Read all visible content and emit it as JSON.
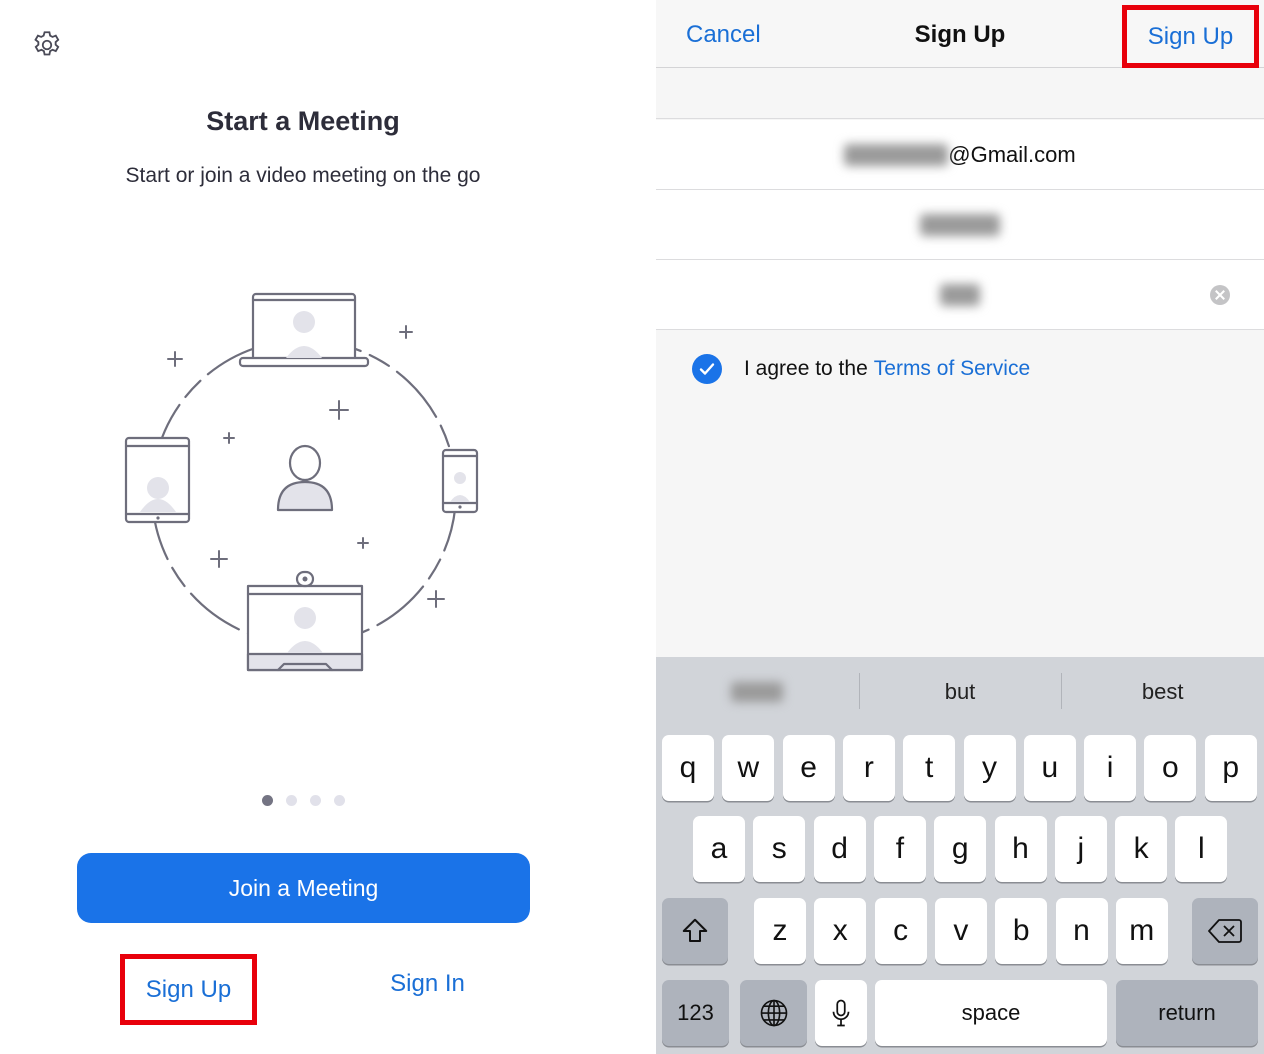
{
  "left": {
    "settings_icon": "gear-icon",
    "title": "Start a Meeting",
    "subtitle": "Start or join a video meeting on the go",
    "page_indicator": {
      "count": 4,
      "active_index": 0
    },
    "join_button": "Join a Meeting",
    "sign_up": "Sign Up",
    "sign_in": "Sign In"
  },
  "right": {
    "nav": {
      "cancel": "Cancel",
      "title": "Sign Up",
      "sign_up": "Sign Up"
    },
    "fields": {
      "email_suffix": "@Gmail.com"
    },
    "agree": {
      "text": "I agree to the",
      "link": "Terms of Service",
      "checked": true
    },
    "keyboard": {
      "suggestions": [
        "",
        "but",
        "best"
      ],
      "row1": [
        "q",
        "w",
        "e",
        "r",
        "t",
        "y",
        "u",
        "i",
        "o",
        "p"
      ],
      "row2": [
        "a",
        "s",
        "d",
        "f",
        "g",
        "h",
        "j",
        "k",
        "l"
      ],
      "row3": [
        "z",
        "x",
        "c",
        "v",
        "b",
        "n",
        "m"
      ],
      "numbers_key": "123",
      "space_key": "space",
      "return_key": "return"
    }
  },
  "colors": {
    "accent": "#1a73e8",
    "link": "#1a6fd6",
    "highlight": "#e8000b"
  }
}
